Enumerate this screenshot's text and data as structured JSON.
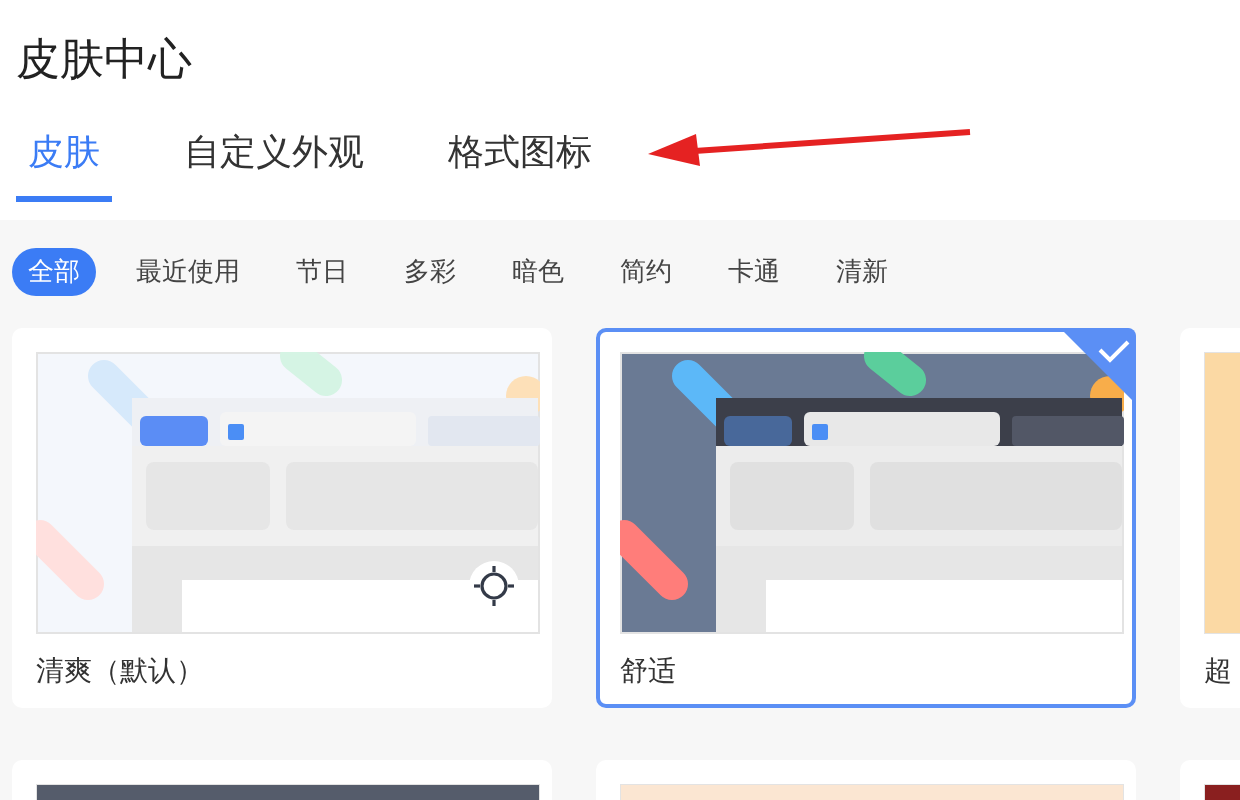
{
  "title": "皮肤中心",
  "tabs": [
    {
      "label": "皮肤",
      "selected": true
    },
    {
      "label": "自定义外观",
      "selected": false
    },
    {
      "label": "格式图标",
      "selected": false
    }
  ],
  "filters": [
    {
      "label": "全部",
      "selected": true
    },
    {
      "label": "最近使用",
      "selected": false
    },
    {
      "label": "节日",
      "selected": false
    },
    {
      "label": "多彩",
      "selected": false
    },
    {
      "label": "暗色",
      "selected": false
    },
    {
      "label": "简约",
      "selected": false
    },
    {
      "label": "卡通",
      "selected": false
    },
    {
      "label": "清新",
      "selected": false
    }
  ],
  "skins": [
    {
      "kind": "light",
      "name": "清爽（默认）",
      "selected": false,
      "badge": {
        "kind": "sun"
      }
    },
    {
      "kind": "dark",
      "name": "舒适",
      "selected": true
    },
    {
      "kind": "warm",
      "name": "超",
      "selected": false
    },
    {
      "kind": "slate",
      "selected": false
    },
    {
      "kind": "peach",
      "selected": false
    },
    {
      "kind": "red",
      "selected": false
    }
  ],
  "annotation": {
    "kind": "arrow"
  }
}
